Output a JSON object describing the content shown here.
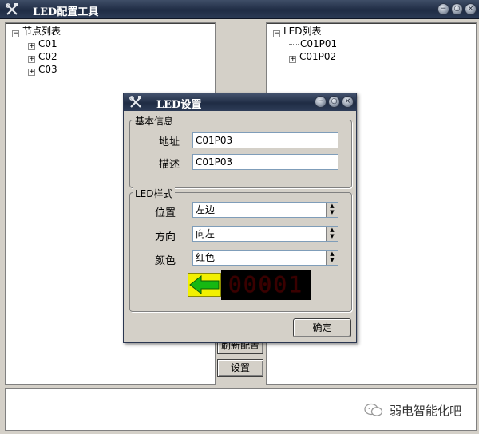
{
  "app": {
    "title": "LED配置工具",
    "title_icon": "tools-icon"
  },
  "window_controls": {
    "minimize": "−",
    "restore": "○",
    "close": "×"
  },
  "left_tree": {
    "root_label": "节点列表",
    "root_toggle": "−",
    "items": [
      {
        "label": "C01",
        "toggle": "+"
      },
      {
        "label": "C02",
        "toggle": "+"
      },
      {
        "label": "C03",
        "toggle": "+"
      }
    ]
  },
  "right_tree": {
    "root_label": "LED列表",
    "root_toggle": "−",
    "items": [
      {
        "label": "C01P01",
        "toggle": ""
      },
      {
        "label": "C01P02",
        "toggle": "+"
      }
    ]
  },
  "middle_buttons": {
    "refresh_label": "刷新配置",
    "settings_label": "设置"
  },
  "watermark": {
    "text": "弱电智能化吧",
    "icon": "wechat-icon"
  },
  "dialog": {
    "title": "LED设置",
    "title_icon": "tools-icon",
    "basic_group": {
      "title": "基本信息",
      "address_label": "地址",
      "address_value": "C01P03",
      "description_label": "描述",
      "description_value": "C01P03"
    },
    "style_group": {
      "title": "LED样式",
      "position_label": "位置",
      "position_value": "左边",
      "direction_label": "方向",
      "direction_value": "向左",
      "color_label": "颜色",
      "color_value": "红色",
      "preview_digits": "00001",
      "preview_arrow": "left-arrow-icon",
      "arrow_color": "#16b812",
      "led_color": "#5a0000"
    },
    "ok_label": "确定"
  }
}
